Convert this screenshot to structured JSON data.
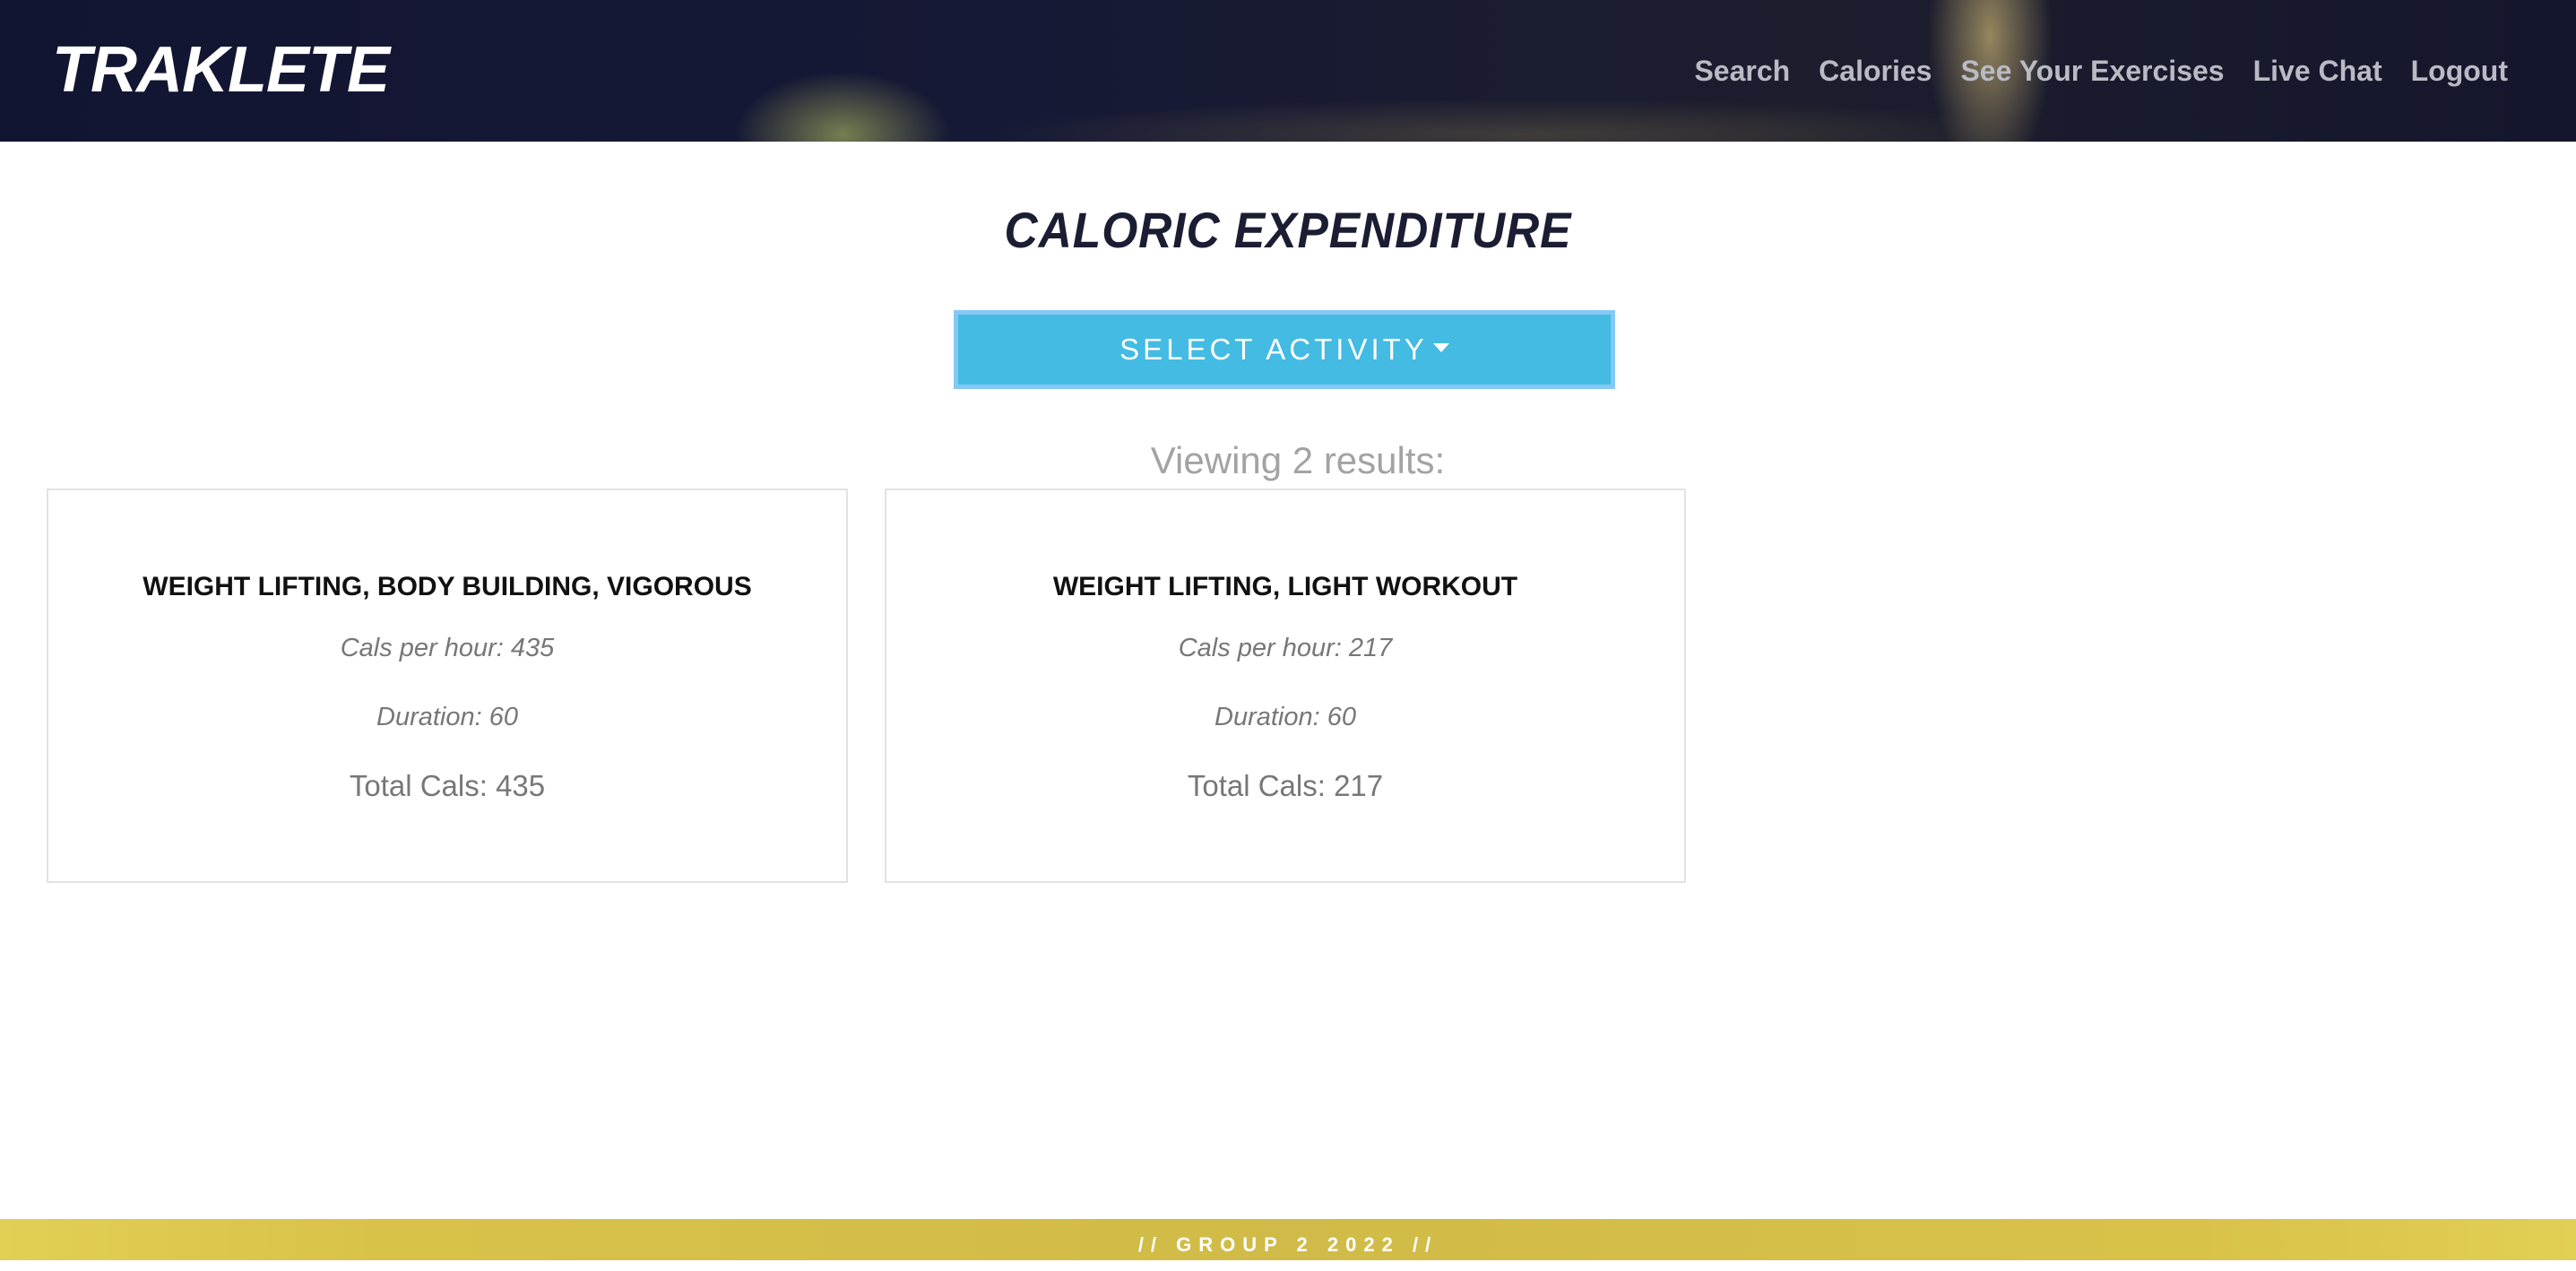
{
  "header": {
    "brand": "TRAKLETE",
    "nav": [
      "Search",
      "Calories",
      "See Your Exercises",
      "Live Chat",
      "Logout"
    ]
  },
  "main": {
    "title": "CALORIC EXPENDITURE",
    "select_label": "SELECT ACTIVITY",
    "results_text": "Viewing 2 results:",
    "cards": [
      {
        "title": "WEIGHT LIFTING, BODY BUILDING, VIGOROUS",
        "cals_per_hour": "Cals per hour: 435",
        "duration": "Duration: 60",
        "total": "Total Cals: 435"
      },
      {
        "title": "WEIGHT LIFTING, LIGHT WORKOUT",
        "cals_per_hour": "Cals per hour: 217",
        "duration": "Duration: 60",
        "total": "Total Cals: 217"
      }
    ]
  },
  "footer": {
    "text": "// GROUP 2 2022 //"
  },
  "colors": {
    "navbar": "#161935",
    "accent_button": "#43bbe2",
    "footer": "#d8c24a",
    "title": "#1b1d33"
  }
}
